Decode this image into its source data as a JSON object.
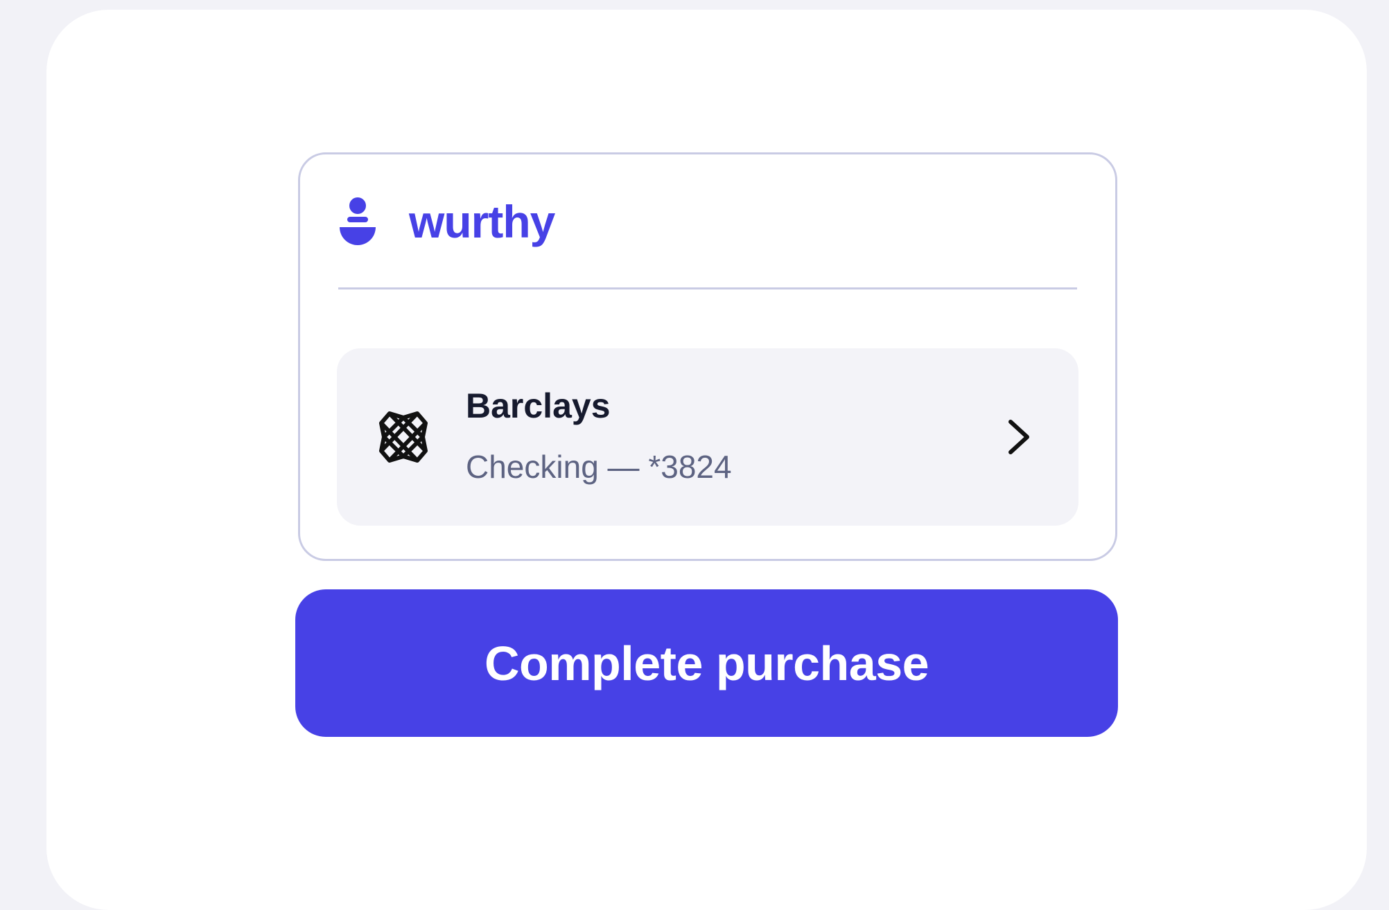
{
  "brand": {
    "name": "wurthy",
    "logo_icon": "wurthy-logo-icon",
    "color": "#4741e6"
  },
  "account": {
    "bank_name": "Barclays",
    "account_label": "Checking — *3824",
    "bank_icon": "bank-lattice-icon",
    "action_icon": "chevron-right-icon"
  },
  "actions": {
    "complete_label": "Complete purchase",
    "button_color": "#4741e6"
  }
}
